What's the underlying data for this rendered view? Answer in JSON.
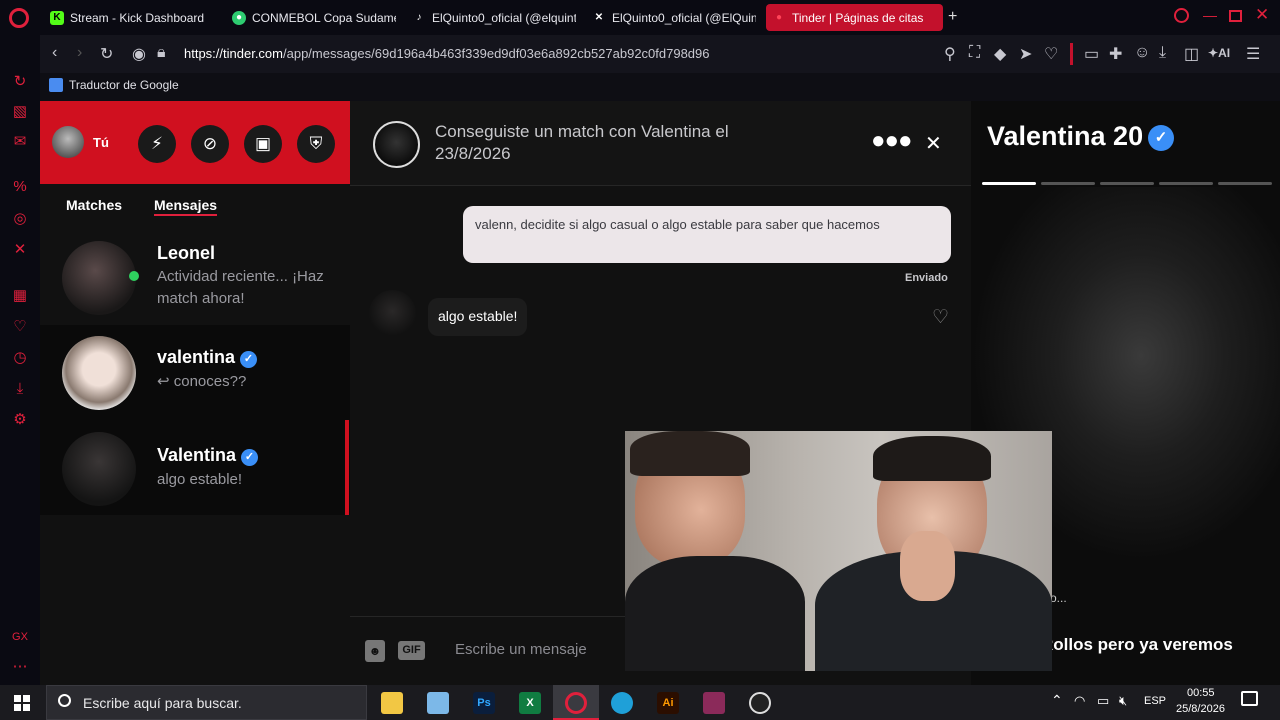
{
  "browser": {
    "tabs": [
      {
        "label": "Stream - Kick Dashboard",
        "icon": "kick-icon",
        "color": "#53fc18"
      },
      {
        "label": "CONMEBOL Copa Sudame",
        "icon": "conmebol-icon",
        "color": "#2ecc71"
      },
      {
        "label": "ElQuinto0_oficial (@elquint",
        "icon": "tiktok-icon",
        "color": "#ffffff"
      },
      {
        "label": "ElQuinto0_oficial (@ElQuin",
        "icon": "x-icon",
        "color": "#ffffff"
      },
      {
        "label": "Tinder | Páginas de citas",
        "icon": "tinder-icon",
        "color": "#ff4458"
      }
    ],
    "url_host": "https://tinder.com",
    "url_path": "/app/messages/69d196a4b463f339ed9df03e6a892cb527ab92c0fd798d96",
    "bookmark": "Traductor de Google",
    "toolbar_ai_label": "AI"
  },
  "tinder": {
    "user_label": "Tú",
    "tabs": {
      "matches": "Matches",
      "messages": "Mensajes"
    },
    "conversations": [
      {
        "name": "Leonel",
        "message": "Actividad reciente... ¡Haz match ahora!",
        "online": true,
        "verified": false
      },
      {
        "name": "valentina",
        "message": "↩ conoces??",
        "online": false,
        "verified": true
      },
      {
        "name": "Valentina",
        "message": "algo estable!",
        "online": false,
        "verified": true
      }
    ],
    "chat": {
      "header": "Conseguiste un match con Valentina el 23/8/2026",
      "outgoing": "valenn, decidite si algo casual o algo estable para saber que hacemos",
      "sent_status": "Enviado",
      "incoming": "algo estable!",
      "gif_label": "GIF",
      "input_placeholder": "Escribe un mensaje"
    },
    "profile": {
      "name_age": "Valentina 20",
      "bio_fragment": "o...",
      "bio_line": "Rollos pero ya veremos"
    }
  },
  "taskbar": {
    "search_placeholder": "Escribe aquí para buscar.",
    "language": "ESP",
    "time": "00:55",
    "date": "25/8/2026"
  },
  "colors": {
    "tinder_red": "#d0101f",
    "verified_blue": "#3a8ff7",
    "active_tab": "#c3112c"
  }
}
